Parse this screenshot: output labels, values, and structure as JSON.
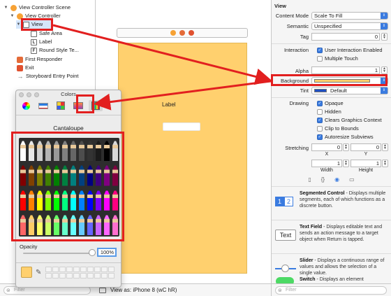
{
  "outline": {
    "items": [
      {
        "label": "View Controller Scene",
        "icon": "vc-scene-icon",
        "glyph": "",
        "disclosure": "▼"
      },
      {
        "label": "View Controller",
        "icon": "view-controller-icon",
        "glyph": "",
        "disclosure": "▼"
      },
      {
        "label": "View",
        "icon": "view-icon",
        "glyph": "",
        "disclosure": "▼"
      },
      {
        "label": "Safe Area",
        "icon": "safe-area-icon",
        "glyph": ""
      },
      {
        "label": "Label",
        "icon": "label-icon",
        "glyph": "L"
      },
      {
        "label": "Round Style Te...",
        "icon": "text-field-icon",
        "glyph": "F"
      },
      {
        "label": "First Responder",
        "icon": "first-responder-icon",
        "glyph": ""
      },
      {
        "label": "Exit",
        "icon": "exit-icon",
        "glyph": ""
      },
      {
        "label": "Storyboard Entry Point",
        "icon": "entry-arrow-icon",
        "glyph": "→"
      }
    ],
    "filter_placeholder": "Filter"
  },
  "canvas": {
    "label_text": "Label",
    "view_as": "View as: iPhone 8 (wC hR)",
    "view_background": "#ffd06e"
  },
  "colors_panel": {
    "title": "Colors",
    "selected_color_name": "Cantaloupe",
    "opacity_label": "Opacity",
    "opacity_value": "100%",
    "opacity_fraction": 1.0,
    "current_color": "#ffd06e",
    "tabs": [
      "color-wheel",
      "color-sliders",
      "color-palettes",
      "image-palettes",
      "pencils"
    ],
    "selected_tab": "pencils",
    "pencil_rows": [
      [
        "#ffffff",
        "#e8e8e8",
        "#cfcfcf",
        "#b5b5b5",
        "#9a9a9a",
        "#808080",
        "#666666",
        "#4d4d4d",
        "#333333",
        "#1a1a1a",
        "#000000",
        "#d9d9d9"
      ],
      [
        "#800000",
        "#804000",
        "#808000",
        "#408000",
        "#008000",
        "#008040",
        "#008080",
        "#004080",
        "#000080",
        "#400080",
        "#800080",
        "#800040"
      ],
      [
        "#ff0000",
        "#ff8000",
        "#ffff00",
        "#80ff00",
        "#00ff00",
        "#00ff80",
        "#00ffff",
        "#0080ff",
        "#0000ff",
        "#8000ff",
        "#ff00ff",
        "#ff0080"
      ],
      [
        "#ff6666",
        "#ffcc66",
        "#ffff66",
        "#ccff66",
        "#66ff66",
        "#66ffcc",
        "#66ffff",
        "#66ccff",
        "#6666ff",
        "#cc66ff",
        "#ff66ff",
        "#ff6fcf"
      ]
    ]
  },
  "inspector": {
    "header": "View",
    "content_mode": {
      "label": "Content Mode",
      "value": "Scale To Fill"
    },
    "semantic": {
      "label": "Semantic",
      "value": "Unspecified"
    },
    "tag": {
      "label": "Tag",
      "value": "0"
    },
    "interaction": {
      "label": "Interaction",
      "user_interaction": "User Interaction Enabled",
      "user_interaction_checked": true,
      "multiple_touch": "Multiple Touch",
      "multiple_touch_checked": false
    },
    "alpha": {
      "label": "Alpha",
      "value": "1"
    },
    "background": {
      "label": "Background",
      "color": "#ffd06e"
    },
    "tint": {
      "label": "Tint",
      "value": "Default",
      "color": "#1d4fc2"
    },
    "drawing": {
      "label": "Drawing",
      "options": [
        {
          "label": "Opaque",
          "checked": true
        },
        {
          "label": "Hidden",
          "checked": false
        },
        {
          "label": "Clears Graphics Context",
          "checked": true
        },
        {
          "label": "Clip to Bounds",
          "checked": false
        },
        {
          "label": "Autoresize Subviews",
          "checked": true
        }
      ]
    },
    "stretching": {
      "label": "Stretching",
      "x": "0",
      "y": "0",
      "width": "1",
      "height": "1",
      "x_label": "X",
      "y_label": "Y",
      "width_label": "Width",
      "height_label": "Height"
    },
    "library_tabs": [
      "file-icon",
      "braces-icon",
      "circle-target-icon",
      "square-icon"
    ],
    "library": [
      {
        "title": "Segmented Control",
        "desc": " - Displays multiple segments, each of which functions as a discrete button.",
        "icon": "segmented-control-icon",
        "seg1": "1",
        "seg2": "2"
      },
      {
        "title": "Text Field",
        "desc": " - Displays editable text and sends an action message to a target object when Return is tapped.",
        "icon": "text-field-icon",
        "icon_text": "Text"
      },
      {
        "title": "Slider",
        "desc": " - Displays a continuous range of values and allows the selection of a single value.",
        "icon": "slider-icon"
      },
      {
        "title": "Switch",
        "desc": " - Displays an element",
        "icon": "switch-icon"
      }
    ],
    "filter_placeholder": "Filter"
  },
  "accent_colors": {
    "highlight_red": "#e21f1f",
    "selection_blue": "#3a7be0"
  }
}
